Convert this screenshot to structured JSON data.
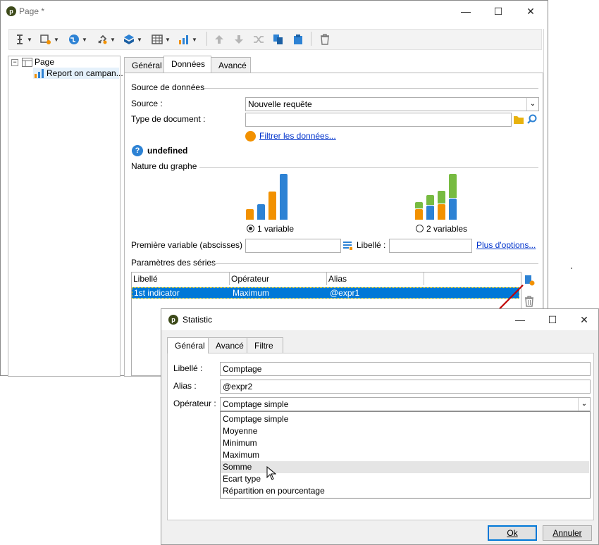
{
  "main_window": {
    "title": "Page *",
    "tree": {
      "root": "Page",
      "child": "Report on campan..."
    },
    "tabs": [
      "Général",
      "Données",
      "Avancé"
    ],
    "source_section": "Source de données",
    "source_label": "Source :",
    "source_value": "Nouvelle requête",
    "doctype_label": "Type de document :",
    "doctype_value": "",
    "filter_link": "Filtrer les données...",
    "undefined_text": "undefined",
    "graph_section": "Nature du graphe",
    "radio_1": "1 variable",
    "radio_2": "2 variables",
    "first_var_label": "Première variable (abscisses) :",
    "first_var_value": "",
    "libelle_label": "Libellé :",
    "libelle_value": "",
    "more_options": "Plus d'options...",
    "series_section": "Paramètres des séries",
    "series_columns": [
      "Libellé",
      "Opérateur",
      "Alias",
      ""
    ],
    "series_rows": [
      [
        "1st indicator",
        "Maximum",
        "@expr1",
        ""
      ]
    ]
  },
  "stat_dialog": {
    "title": "Statistic",
    "tabs": [
      "Général",
      "Avancé",
      "Filtre"
    ],
    "libelle_label": "Libellé :",
    "libelle_value": "Comptage",
    "alias_label": "Alias :",
    "alias_value": "@expr2",
    "operator_label": "Opérateur :",
    "operator_value": "Comptage simple",
    "operator_options": [
      "Comptage simple",
      "Moyenne",
      "Minimum",
      "Maximum",
      "Somme",
      "Ecart type",
      "Répartition en pourcentage"
    ],
    "hovered_option": "Somme",
    "ok": "Ok",
    "cancel": "Annuler"
  },
  "colors": {
    "selection": "#0078d7",
    "orange": "#f29100",
    "blue": "#2d82d4",
    "green": "#77bb41",
    "link": "#0033cc",
    "arrow": "#c00000"
  },
  "icons": [
    "app-icon",
    "minimize-icon",
    "maximize-icon",
    "close-icon",
    "text-cursor-icon",
    "filter-icon",
    "globe-icon",
    "link-icon",
    "cube-icon",
    "table-icon",
    "chart-icon",
    "arrow-up-icon",
    "arrow-down-icon",
    "shuffle-icon",
    "copy-icon",
    "clipboard-icon",
    "trash-icon",
    "folder-icon",
    "search-icon",
    "help-icon",
    "list-icon",
    "edit-icon",
    "cursor-icon"
  ]
}
